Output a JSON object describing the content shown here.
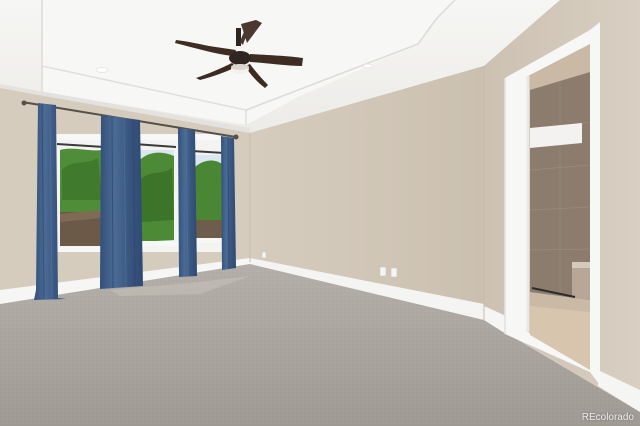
{
  "watermark": "REcolorado",
  "colors": {
    "ceiling": "#f3f3f1",
    "wall_left": "#d7cdbf",
    "wall_back": "#d2c8ba",
    "wall_right": "#d9cfc2",
    "carpet": "#a9a49e",
    "curtain": "#3e5d86",
    "baseboard": "#f7f7f5",
    "fan_blade": "#3d2b22",
    "foliage": "#4e8a37",
    "sky": "#dfeaf3",
    "tile": "#8c7d6e"
  },
  "icons": [
    "ceiling-fan-icon",
    "recessed-light-icon",
    "electrical-outlet-icon",
    "curtain-rod-icon"
  ]
}
